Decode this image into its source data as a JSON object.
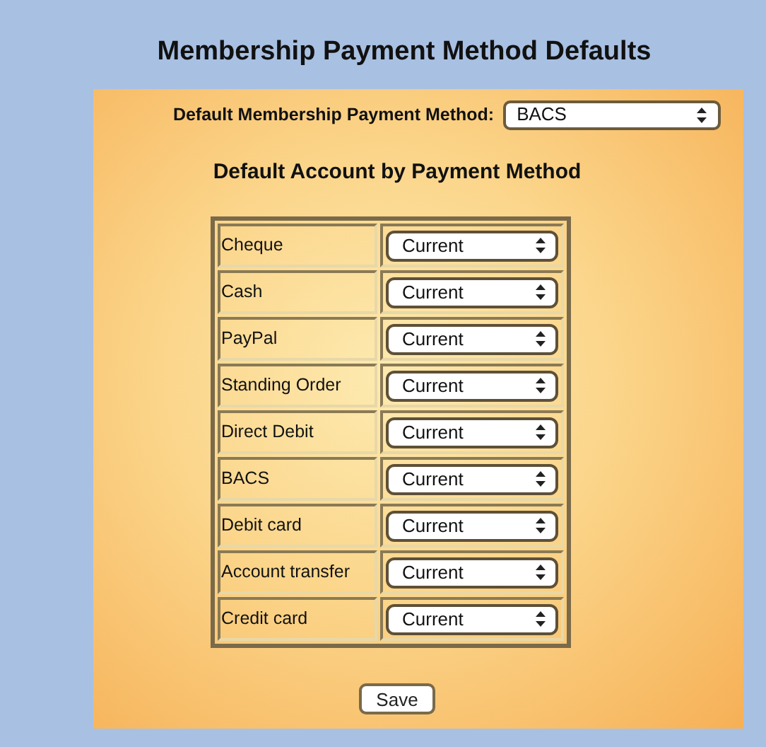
{
  "title": "Membership Payment Method Defaults",
  "default_method": {
    "label": "Default Membership Payment Method:",
    "value": "BACS"
  },
  "accounts_heading": "Default Account by Payment Method",
  "accounts": [
    {
      "method": "Cheque",
      "account": "Current"
    },
    {
      "method": "Cash",
      "account": "Current"
    },
    {
      "method": "PayPal",
      "account": "Current"
    },
    {
      "method": "Standing Order",
      "account": "Current"
    },
    {
      "method": "Direct Debit",
      "account": "Current"
    },
    {
      "method": "BACS",
      "account": "Current"
    },
    {
      "method": "Debit card",
      "account": "Current"
    },
    {
      "method": "Account transfer",
      "account": "Current"
    },
    {
      "method": "Credit card",
      "account": "Current"
    }
  ],
  "save_button": "Save"
}
